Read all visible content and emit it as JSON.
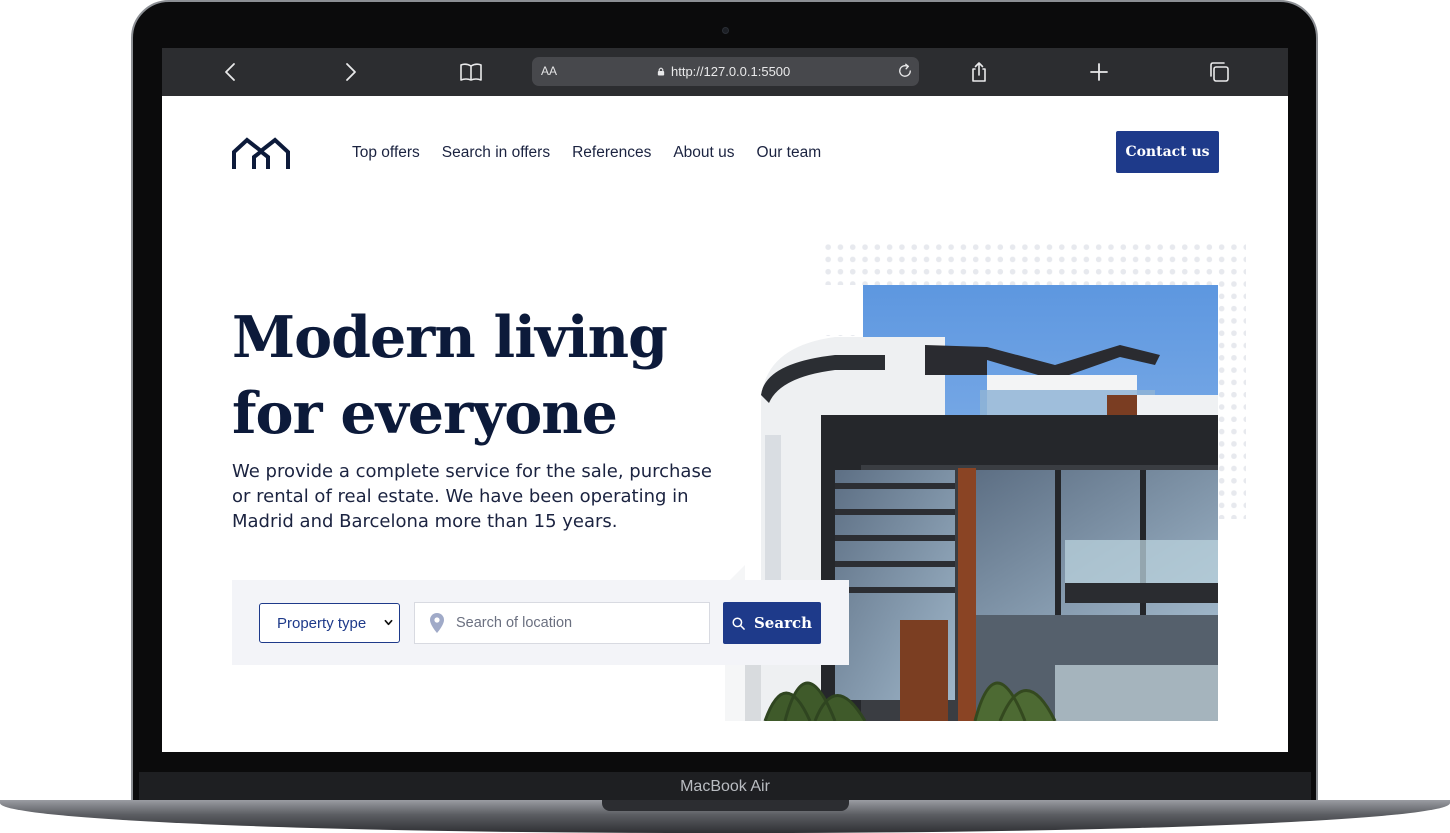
{
  "device": {
    "label": "MacBook Air"
  },
  "browser": {
    "reader_label": "AA",
    "url": "http://127.0.0.1:5500",
    "icons": [
      "back-icon",
      "forward-icon",
      "book-icon",
      "lock-icon",
      "reload-icon",
      "share-icon",
      "plus-icon",
      "tabs-icon"
    ]
  },
  "header": {
    "logo_icon": "house-logo-icon",
    "nav": [
      "Top offers",
      "Search in offers",
      "References",
      "About us",
      "Our team"
    ],
    "contact_label": "Contact us"
  },
  "hero": {
    "title_line1": "Modern living",
    "title_line2": "for everyone",
    "description": "We provide a complete service for the sale, purchase or rental of real estate. We have been operating in Madrid and Barcelona more than 15 years."
  },
  "search": {
    "property_type": "Property type",
    "location_placeholder": "Search of location",
    "button_label": "Search",
    "icons": [
      "map-pin-icon",
      "search-icon"
    ]
  },
  "colors": {
    "primary": "#1e3a8a",
    "heading": "#0c1a3a",
    "panel": "#f3f4f8",
    "browser_bar": "#2c2d30"
  }
}
